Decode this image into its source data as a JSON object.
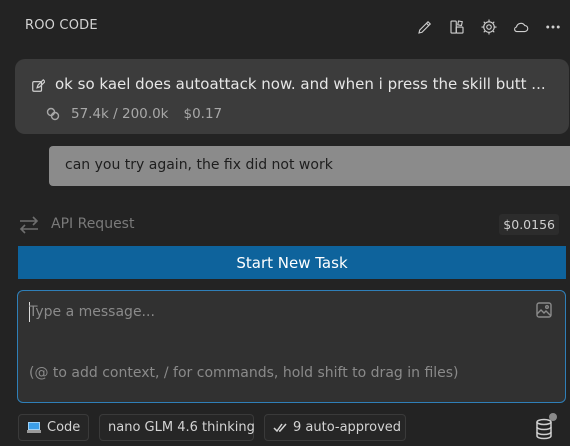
{
  "header": {
    "title": "ROO CODE",
    "icons": [
      "pencil-icon",
      "marketplace-icon",
      "gear-icon",
      "cloud-icon",
      "more-icon"
    ]
  },
  "task": {
    "text": "ok so kael does autoattack now. and when i press the skill butt ...",
    "context": "57.4k / 200.0k",
    "cost": "$0.17"
  },
  "user_message": {
    "text": "can you try again, the fix did not work"
  },
  "api_request": {
    "label": "API Request",
    "cost": "$0.0156"
  },
  "start_button": {
    "label": "Start New Task"
  },
  "input": {
    "placeholder": "Type a message...",
    "hint": "(@ to add context, / for commands, hold shift to drag in files)"
  },
  "bottom_bar": {
    "mode": "Code",
    "model": "nano GLM 4.6 thinking",
    "auto_approved": "9 auto-approved"
  },
  "colors": {
    "background": "#232323",
    "card": "#3c3c3c",
    "accent": "#0e639c",
    "focus_border": "#2f7fb8",
    "user_bubble": "#8b8b8b"
  }
}
